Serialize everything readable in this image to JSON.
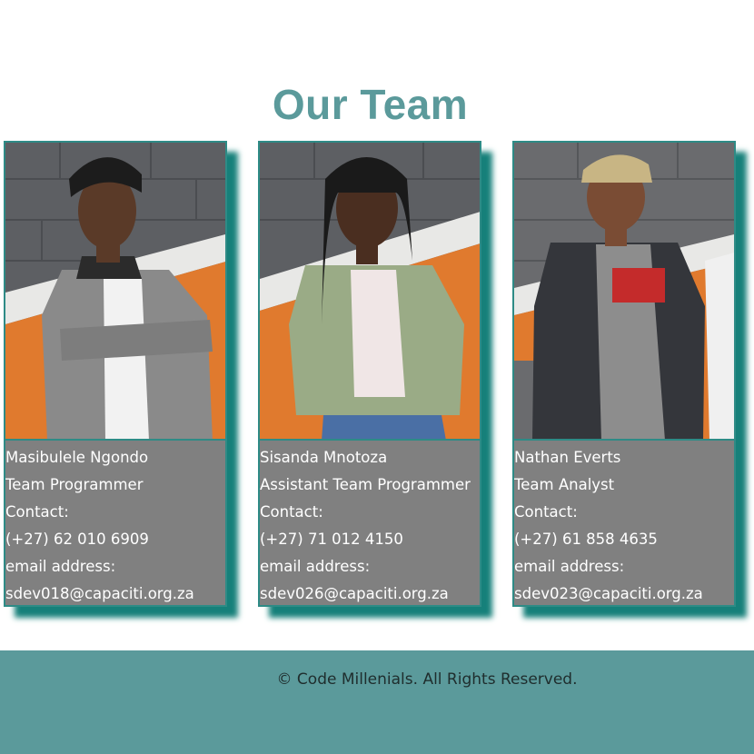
{
  "page": {
    "heading": "Our Team"
  },
  "team": [
    {
      "name": "Masibulele Ngondo",
      "role": "Team Programmer",
      "contact_label": "Contact:",
      "phone": "(+27) 62 010 6909",
      "email_label": "email address:",
      "email": "sdev018@capaciti.org.za",
      "photo": "team-member-photo"
    },
    {
      "name": "Sisanda Mnotoza",
      "role": "Assistant Team Programmer",
      "contact_label": "Contact:",
      "phone": "(+27) 71 012 4150",
      "email_label": "email address:",
      "email": "sdev026@capaciti.org.za",
      "photo": "team-member-photo"
    },
    {
      "name": "Nathan Everts",
      "role": "Team Analyst",
      "contact_label": "Contact:",
      "phone": "(+27) 61 858 4635",
      "email_label": "email address:",
      "email": "sdev023@capaciti.org.za",
      "photo": "team-member-photo"
    }
  ],
  "footer": {
    "text": "© Code Millenials. All Rights Reserved."
  },
  "colors": {
    "accent": "#5b9a9b",
    "card_border": "#2e8b86",
    "card_shadow": "#16807a",
    "card_bg": "#808080",
    "wall_orange": "#e07a2e",
    "wall_gray": "#5d5f63"
  }
}
